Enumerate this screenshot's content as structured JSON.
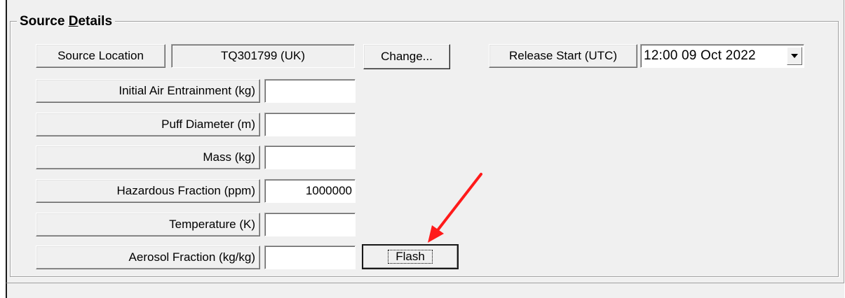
{
  "group": {
    "title_before": "Source ",
    "title_accel": "D",
    "title_after": "etails"
  },
  "source_location": {
    "label": "Source Location",
    "value": "TQ301799 (UK)",
    "change_label": "Change..."
  },
  "release_start": {
    "label": "Release Start (UTC)",
    "value": "12:00 09 Oct  2022"
  },
  "fields": [
    {
      "label": "Initial Air Entrainment (kg)",
      "value": ""
    },
    {
      "label": "Puff Diameter (m)",
      "value": ""
    },
    {
      "label": "Mass (kg)",
      "value": ""
    },
    {
      "label": "Hazardous Fraction (ppm)",
      "value": "1000000"
    },
    {
      "label": "Temperature (K)",
      "value": ""
    },
    {
      "label": "Aerosol Fraction (kg/kg)",
      "value": ""
    }
  ],
  "flash_button": {
    "label": "Flash"
  },
  "annotation": {
    "color": "#ff1a1a"
  },
  "icons": {
    "dropdown": "chevron-down-icon",
    "annotation": "arrow-icon"
  }
}
